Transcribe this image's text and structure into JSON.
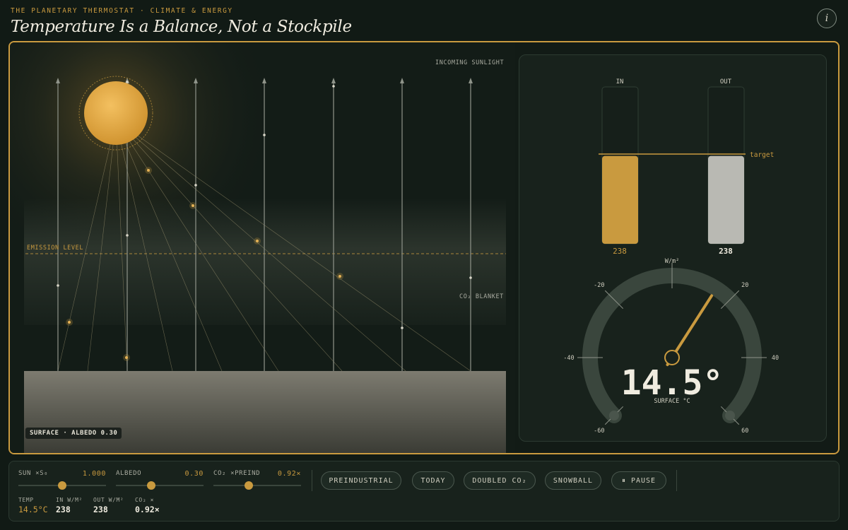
{
  "header": {
    "kicker": "THE PLANETARY THERMOSTAT · CLIMATE & ENERGY",
    "title": "Temperature Is a Balance, Not a Stockpile",
    "info_icon": "info-icon"
  },
  "scene": {
    "incoming_label": "INCOMING SUNLIGHT",
    "emission_label": "EMISSION LEVEL",
    "blanket_label": "CO₂ BLANKET",
    "surface_label": "SURFACE · ALBEDO 0.30"
  },
  "panel": {
    "in_label": "IN",
    "out_label": "OUT",
    "target_label": "target",
    "in_value": "238",
    "out_value": "238",
    "in_fill_fraction": 0.5,
    "out_fill_fraction": 0.5,
    "gauge_unit": "W/m²",
    "gauge_ticks": [
      "-60",
      "-40",
      "-20",
      "20",
      "40",
      "60"
    ],
    "temperature": "14.5°",
    "temperature_value": 14.5,
    "temperature_caption": "SURFACE °C"
  },
  "controls": {
    "sliders": [
      {
        "label": "SUN ×S₀",
        "value": "1.000",
        "position": 0.5
      },
      {
        "label": "ALBEDO",
        "value": "0.30",
        "position": 0.4
      },
      {
        "label": "CO₂ ×PREIND",
        "value": "0.92×",
        "position": 0.4
      }
    ],
    "buttons": [
      "PREINDUSTRIAL",
      "TODAY",
      "DOUBLED CO₂",
      "SNOWBALL",
      "⏸ PAUSE"
    ],
    "readouts": [
      {
        "label": "TEMP",
        "value": "14.5°C"
      },
      {
        "label": "IN W/M²",
        "value": "238"
      },
      {
        "label": "OUT W/M²",
        "value": "238"
      },
      {
        "label": "CO₂ ×",
        "value": "0.92×"
      }
    ]
  },
  "colors": {
    "accent": "#c99a3f",
    "background": "#111a15",
    "panel": "#18221c",
    "out_bar": "#b9b9b3"
  }
}
